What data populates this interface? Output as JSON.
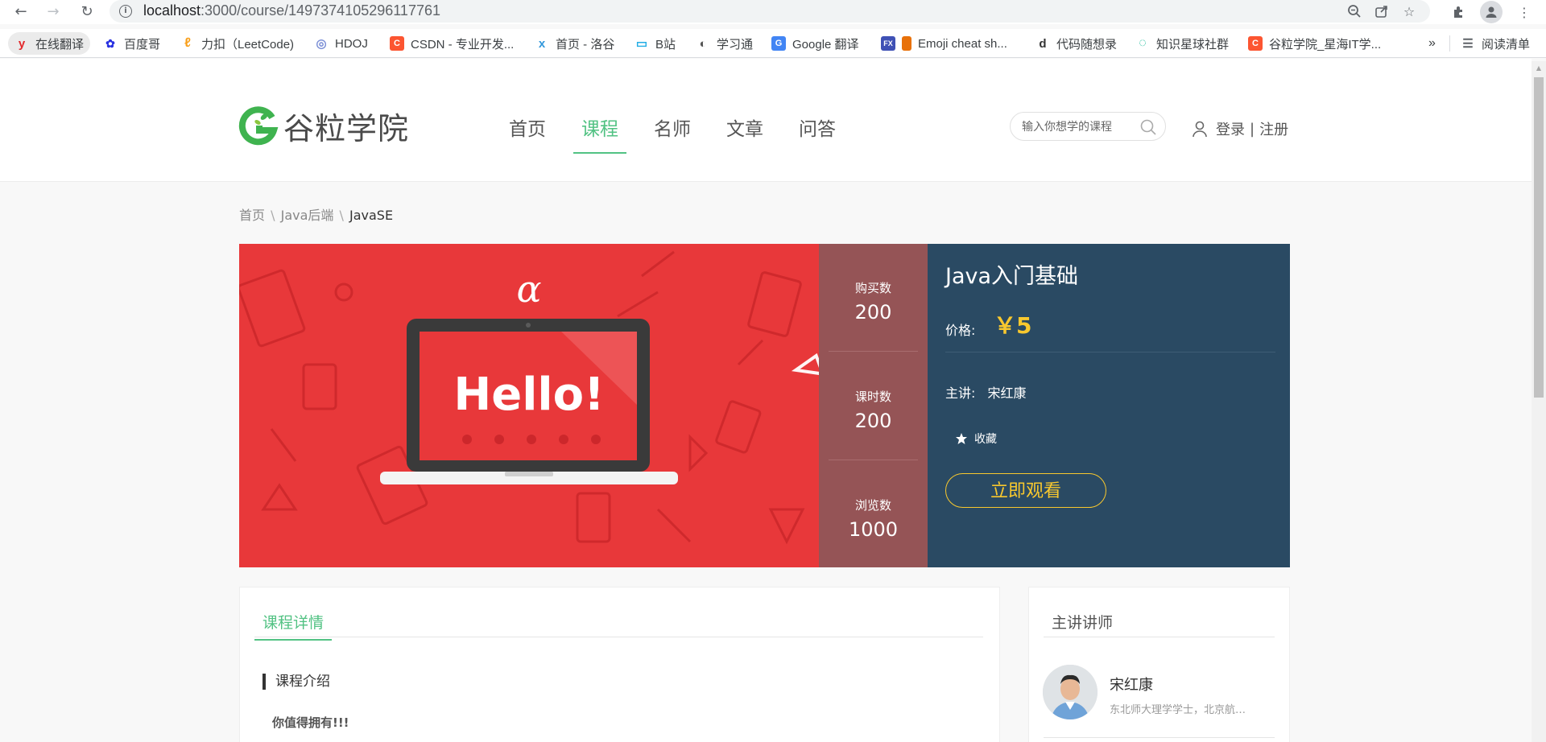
{
  "browser": {
    "url_host": "localhost",
    "url_path": ":3000/course/1497374105296117761",
    "bookmarks": [
      {
        "label": "在线翻译",
        "icon": "youdao-icon",
        "color": "#e3282b",
        "glyph": "y"
      },
      {
        "label": "百度哥",
        "icon": "baidu-icon",
        "color": "#2932e1",
        "glyph": "✿"
      },
      {
        "label": "力扣（LeetCode)",
        "icon": "leetcode-icon",
        "color": "#f89f1b",
        "glyph": "ℓ"
      },
      {
        "label": "HDOJ",
        "icon": "hdoj-icon",
        "color": "#7b8fd6",
        "glyph": "◎"
      },
      {
        "label": "CSDN - 专业开发...",
        "icon": "csdn-icon",
        "color": "#fc5531",
        "glyph": "C"
      },
      {
        "label": "首页 - 洛谷",
        "icon": "luogu-icon",
        "color": "#3498db",
        "glyph": "x"
      },
      {
        "label": "B站",
        "icon": "bilibili-icon",
        "color": "#23ade5",
        "glyph": "▭"
      },
      {
        "label": "学习通",
        "icon": "xuexitong-icon",
        "color": "#555555",
        "glyph": "◐"
      },
      {
        "label": "Google 翻译",
        "icon": "google-translate-icon",
        "color": "#4285f4",
        "glyph": "G"
      },
      {
        "label": "Emoji cheat sh...",
        "icon": "emoji-cheat-icon",
        "color": "#e8710a",
        "glyph": "▮"
      },
      {
        "label": "代码随想录",
        "icon": "code-icon",
        "color": "#333333",
        "glyph": "d"
      },
      {
        "label": "知识星球社群",
        "icon": "zsxq-icon",
        "color": "#16b998",
        "glyph": "◌"
      },
      {
        "label": "谷粒学院_星海IT学...",
        "icon": "csdn-icon",
        "color": "#fc5531",
        "glyph": "C"
      }
    ],
    "more": "»",
    "reading_list": "阅读清单"
  },
  "site": {
    "logo_text": "谷粒学院",
    "nav": [
      "首页",
      "课程",
      "名师",
      "文章",
      "问答"
    ],
    "nav_active": 1,
    "search_placeholder": "输入你想学的课程",
    "login": "登录",
    "sep": "|",
    "register": "注册",
    "accent": "#52c283"
  },
  "breadcrumb": {
    "home": "首页",
    "category": "Java后端",
    "current": "JavaSE",
    "divider": "\\"
  },
  "course": {
    "banner_text": "Hello!",
    "stats": [
      {
        "label": "购买数",
        "value": "200"
      },
      {
        "label": "课时数",
        "value": "200"
      },
      {
        "label": "浏览数",
        "value": "1000"
      }
    ],
    "title": "Java入门基础",
    "price_label": "价格:",
    "price": "￥5",
    "teacher_label": "主讲:",
    "teacher_name": "宋红康",
    "favorite": "收藏",
    "watch_button": "立即观看"
  },
  "detail": {
    "tab": "课程详情",
    "intro_heading": "课程介绍",
    "intro_text": "你值得拥有!!!"
  },
  "teacher_panel": {
    "heading": "主讲讲师",
    "name": "宋红康",
    "desc": "东北师大理学学士，北京航空航天大学..."
  }
}
